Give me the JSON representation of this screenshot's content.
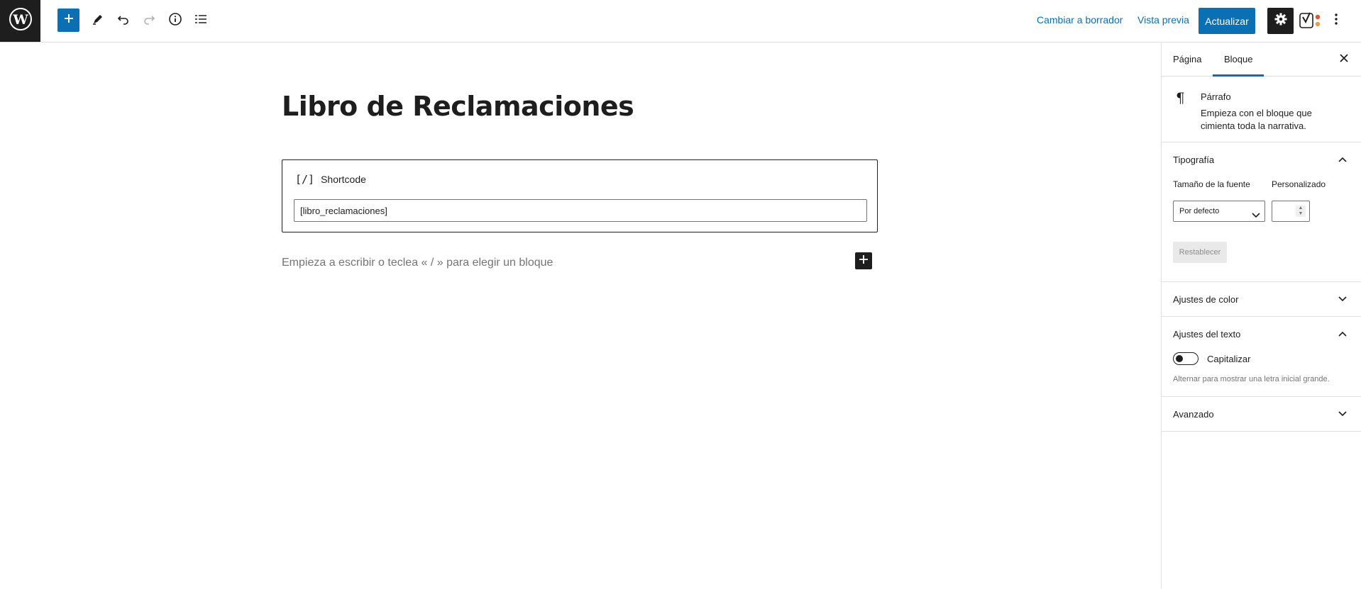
{
  "toolbar": {
    "wp_logo_icon": "wordpress-icon",
    "add_icon": "plus-icon",
    "tools_icon": "pencil-icon",
    "undo_icon": "undo-icon",
    "redo_icon": "redo-icon",
    "info_icon": "info-icon",
    "list_view_icon": "list-view-icon",
    "switch_to_draft": "Cambiar a borrador",
    "preview": "Vista previa",
    "update": "Actualizar",
    "settings_icon": "gear-icon",
    "yoast_icon": "yoast-icon",
    "more_icon": "kebab-menu-icon",
    "accent_color": "#0a6fb3"
  },
  "editor": {
    "title": "Libro de Reclamaciones",
    "shortcode_block": {
      "icon": "shortcode-icon",
      "icon_glyph": "[/]",
      "label": "Shortcode",
      "value": "[libro_reclamaciones]"
    },
    "paragraph_placeholder": "Empieza a escribir o teclea « / » para elegir un bloque",
    "inline_add_icon": "plus-icon"
  },
  "sidebar": {
    "tabs": [
      {
        "label": "Página",
        "active": false
      },
      {
        "label": "Bloque",
        "active": true
      }
    ],
    "close_icon": "close-icon",
    "block_card": {
      "icon": "paragraph-icon",
      "icon_glyph": "¶",
      "title": "Párrafo",
      "description": "Empieza con el bloque que cimienta toda la narrativa."
    },
    "typography": {
      "title": "Tipografía",
      "expanded": true,
      "font_size_label": "Tamaño de la fuente",
      "custom_label": "Personalizado",
      "font_size_value": "Por defecto",
      "custom_value": "",
      "reset_label": "Restablecer"
    },
    "color": {
      "title": "Ajustes de color",
      "expanded": false
    },
    "text": {
      "title": "Ajustes del texto",
      "expanded": true,
      "dropcap_label": "Capitalizar",
      "dropcap_on": false,
      "help": "Alternar para mostrar una letra inicial grande."
    },
    "advanced": {
      "title": "Avanzado",
      "expanded": false
    }
  }
}
